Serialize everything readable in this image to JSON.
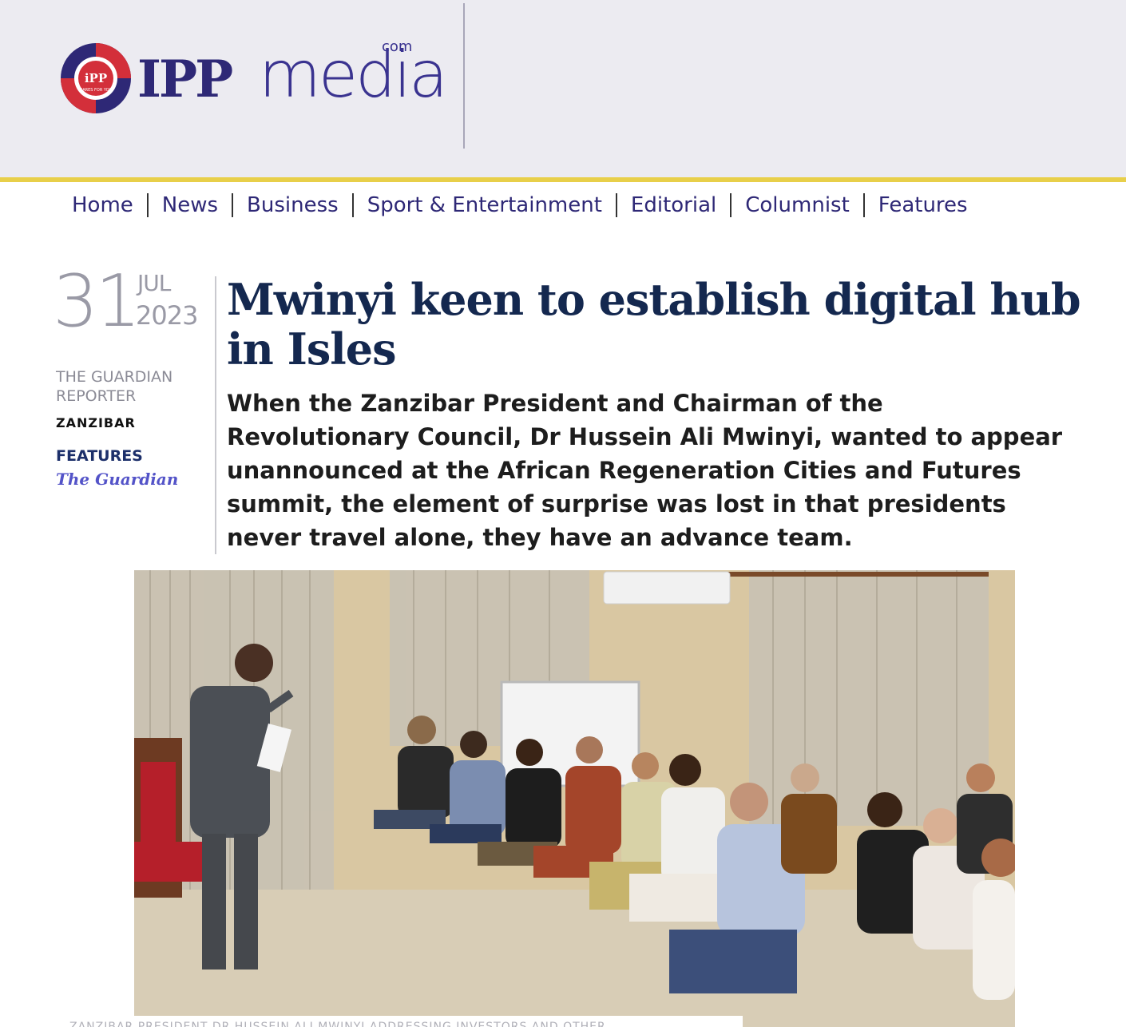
{
  "masthead": {
    "logo_ipp": "IPP",
    "logo_media": "media",
    "logo_com": "com",
    "logo_badge": "iPP",
    "logo_tagline": "CARES FOR YOU"
  },
  "nav": {
    "items": [
      "Home",
      "News",
      "Business",
      "Sport & Entertainment",
      "Editorial",
      "Columnist",
      "Features"
    ]
  },
  "article": {
    "date_day": "31",
    "date_month": "JUL",
    "date_year": "2023",
    "author": "THE GUARDIAN REPORTER",
    "location": "ZANZIBAR",
    "section": "FEATURES",
    "publication": "The Guardian",
    "headline": "Mwinyi keen to establish digital hub in Isles",
    "standfirst": "When the Zanzibar President and Chairman of the Revolutionary Council, Dr Hussein Ali Mwinyi, wanted to appear unannounced at the African Regeneration Cities and Futures summit, the element of surprise was lost in that presidents never travel alone, they have an advance team.",
    "caption": "ZANZIBAR PRESIDENT DR HUSSEIN ALI MWINYI ADDRESSING INVESTORS AND OTHER"
  },
  "colors": {
    "brand_navy": "#2e2876",
    "brand_red": "#d32f3a",
    "gold_rule": "#e8cf4a",
    "headline": "#14284f"
  }
}
